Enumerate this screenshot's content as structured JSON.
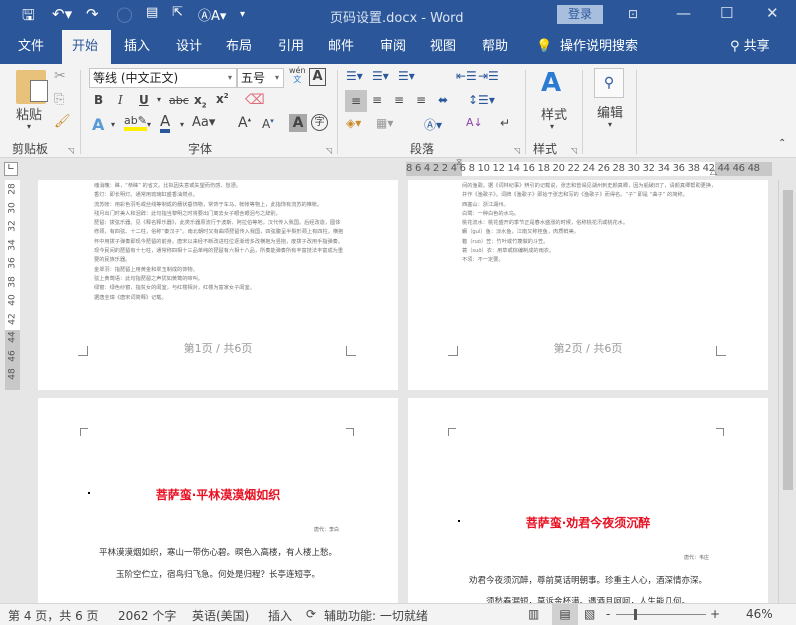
{
  "titlebar": {
    "title": "页码设置.docx  -  Word",
    "login": "登录",
    "quick_access": [
      "save-icon",
      "undo-icon",
      "redo-icon",
      "circle-icon",
      "touch-mode-icon",
      "read-mode-icon",
      "font-size-icon"
    ]
  },
  "tabs": [
    "文件",
    "开始",
    "插入",
    "设计",
    "布局",
    "引用",
    "邮件",
    "审阅",
    "视图",
    "帮助"
  ],
  "tell_me": "操作说明搜索",
  "share": "共享",
  "ribbon": {
    "clipboard": {
      "label": "剪贴板",
      "paste": "粘贴"
    },
    "font": {
      "label": "字体",
      "font_name": "等线 (中文正文)",
      "font_size": "五号",
      "wen": "wén",
      "wen2": "文"
    },
    "paragraph": {
      "label": "段落"
    },
    "styles": {
      "label": "样式",
      "button": "样式"
    },
    "editing": {
      "button": "编辑"
    }
  },
  "ruler": {
    "numbers": "8  6  4  2     2  4  6  8 10 12 14 16 18 20 22 24 26 28 30 32 34 36 38     42 44 46 48",
    "vertical": [
      "28",
      "30",
      "32",
      "34",
      "36",
      "38",
      "40",
      "42",
      "44",
      "46",
      "48"
    ]
  },
  "pages": [
    {
      "notes": [
        "魂消魄：睐，“恭睐” 的省文。比拟因失意或失望而伤感、愁懑。",
        "香灯：即长明灯。通常用琉璃缸盛香油燃点。",
        "流苏帐：用彩色羽毛或丝线等制成的穗状垂饰物，常饰于车马、帐帐等物上，此指饰有流苏的帷帐。",
        "残月出门时美人和泪辞：此句指当黎明之时将要出门离去女子眼含眼泪与之辞别。",
        "琵琶：拨弦乐器。见《释名释乐器》，此类乐器原流行于波斯、阿拉伯等地，汉代传入我国。后经改造，圆体修颈，有四弦、十二柱，俗称“秦汉子”。南北朝时又有曲项琵琶传入我国，四弦腹呈半梨形颈上有四柱，横抱怀中用拨子弹奏即现今琵琶的前身。唐宋以来经不断改进柱位逐渐增多改横抱为竖抱，废拨子改用手指弹奏。现今民间的琵琶有十七柱，通常称四相十三品单纯的琵琶有六相十八品，所奏能弹奏所有丰富技法丰富成为重要的民族乐器。",
        "金翠羽：指琵琶上用黄金和翠玉制成的饰物。",
        "弦上黄莺语：此句指琵琶之声犹如黄莺的啼叫。",
        "绿窗：绿色纱窗，指贫女的闺室，与红楼相对，红楼为富家女子闺室。",
        "据唐圭璋《唐宋词简释》记载。"
      ],
      "footer": "第1页 / 共6页"
    },
    {
      "notes": [
        "间的渔歌。据《词林纪事》辨引的记载说，张志和曾谒见湖州刺史颜真卿，因为船破旧了，请颜真卿帮助更换，并作《渔歌子》。词牌《渔歌子》即始于张志和写的《渔歌子》而得名。“子” 即是 “曲子” 的简称。",
        "西塞山：浙江湖州。",
        "白鹭：一种白色的水鸟。",
        "桃花流水：桃花盛开的季节正是春水盛涨的时候，俗称桃花汛或桃花水。",
        "鳜（guì）鱼：淡水鱼，江南又称桂鱼，肉质鲜美。",
        "箬（ruò）笠：竹叶或竹篾做的斗笠。",
        "蓑（suō）衣：用草或棕编制成的雨衣。",
        "不须：不一定要。"
      ],
      "footer": "第2页 / 共6页"
    },
    {
      "title": "菩萨蛮·平林漠漠烟如织",
      "author": "唐代：李白",
      "verses": [
        "平林漠漠烟如织，寒山一带伤心碧。暝色入高楼，有人楼上愁。",
        "玉阶空伫立，宿鸟归飞急。何处是归程？长亭连短亭。"
      ]
    },
    {
      "title": "菩萨蛮·劝君今夜须沉醉",
      "author": "唐代：韦庄",
      "verses": [
        "劝君今夜须沉醉，尊前莫话明朝事。珍重主人心，酒深情亦深。",
        "须愁春漏短，莫诉金杯满。遇酒且呵呵，人生能几何。"
      ]
    }
  ],
  "status": {
    "page": "第 4 页，共 6 页",
    "words": "2062 个字",
    "language": "英语(美国)",
    "mode": "插入",
    "accessibility": "辅助功能: 一切就绪",
    "zoom": "46%",
    "zoom_percent": 46
  },
  "colors": {
    "accent": "#2b579a",
    "title_red": "#e81123"
  }
}
